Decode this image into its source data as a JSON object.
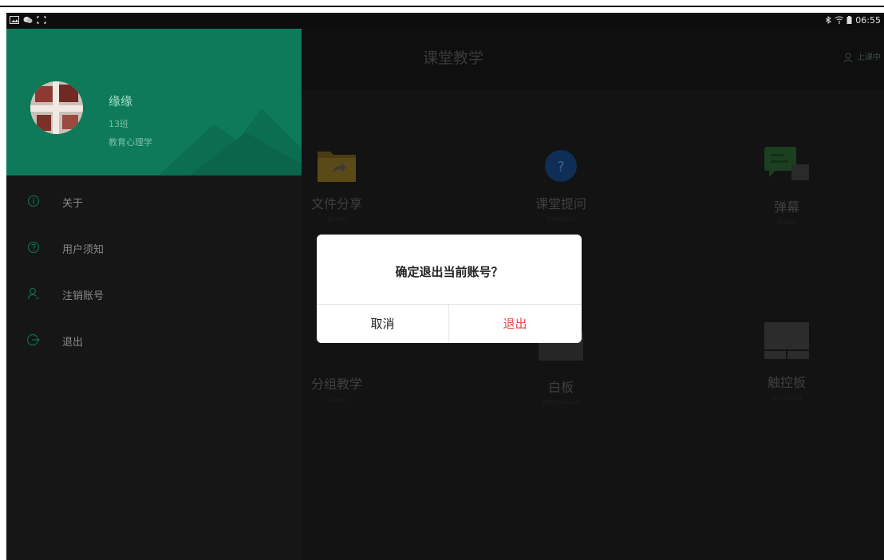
{
  "status_bar": {
    "time": "06:55"
  },
  "main": {
    "title": "课堂教学",
    "header_right": "上课中",
    "tiles": [
      {
        "label": "文件分享",
        "icon": "folder-share-icon"
      },
      {
        "label": "课堂提问",
        "icon": "question-icon",
        "glyph": "?"
      },
      {
        "label": "弹幕",
        "icon": "chat-bubbles-icon"
      },
      {
        "label": "分组教学",
        "icon": "group-icon"
      },
      {
        "label": "白板",
        "icon": "whiteboard-icon"
      },
      {
        "label": "触控板",
        "icon": "touchpad-icon"
      }
    ]
  },
  "drawer": {
    "user": {
      "name": "缘缘",
      "class": "13班",
      "course": "教育心理学"
    },
    "menu": [
      {
        "label": "关于",
        "icon": "info-icon"
      },
      {
        "label": "用户须知",
        "icon": "help-icon"
      },
      {
        "label": "注销账号",
        "icon": "user-icon"
      },
      {
        "label": "退出",
        "icon": "logout-icon"
      }
    ]
  },
  "dialog": {
    "message": "确定退出当前账号？",
    "cancel_label": "取消",
    "confirm_label": "退出"
  },
  "colors": {
    "drawer_header": "#0e7a59",
    "confirm_red": "#e84a4a"
  }
}
